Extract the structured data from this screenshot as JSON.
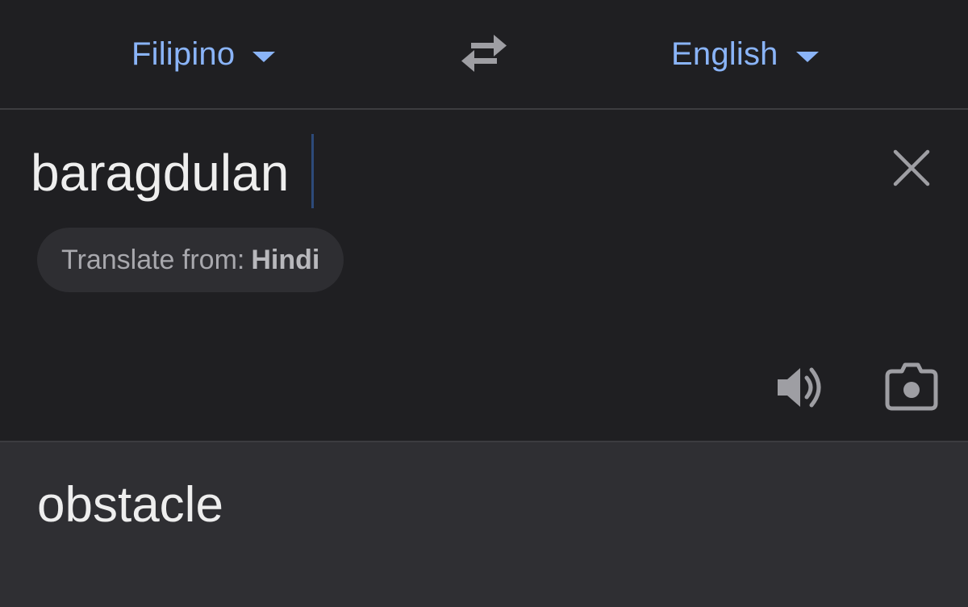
{
  "language_bar": {
    "source_language": "Filipino",
    "target_language": "English"
  },
  "input": {
    "value": "baragdulan",
    "detect_chip": {
      "prefix": "Translate from:",
      "language": "Hindi"
    }
  },
  "output": {
    "translation": "obstacle"
  },
  "icons": {
    "swap": "swap-languages-icon",
    "clear": "close-icon",
    "speaker": "speaker-icon",
    "camera": "camera-icon",
    "dropdown": "caret-down-icon"
  },
  "colors": {
    "background": "#1f1f22",
    "output_background": "#2f2f33",
    "accent": "#8ab4f8",
    "text": "#eeeeee",
    "icon": "#9e9ea3",
    "chip_background": "#2e2e32"
  }
}
